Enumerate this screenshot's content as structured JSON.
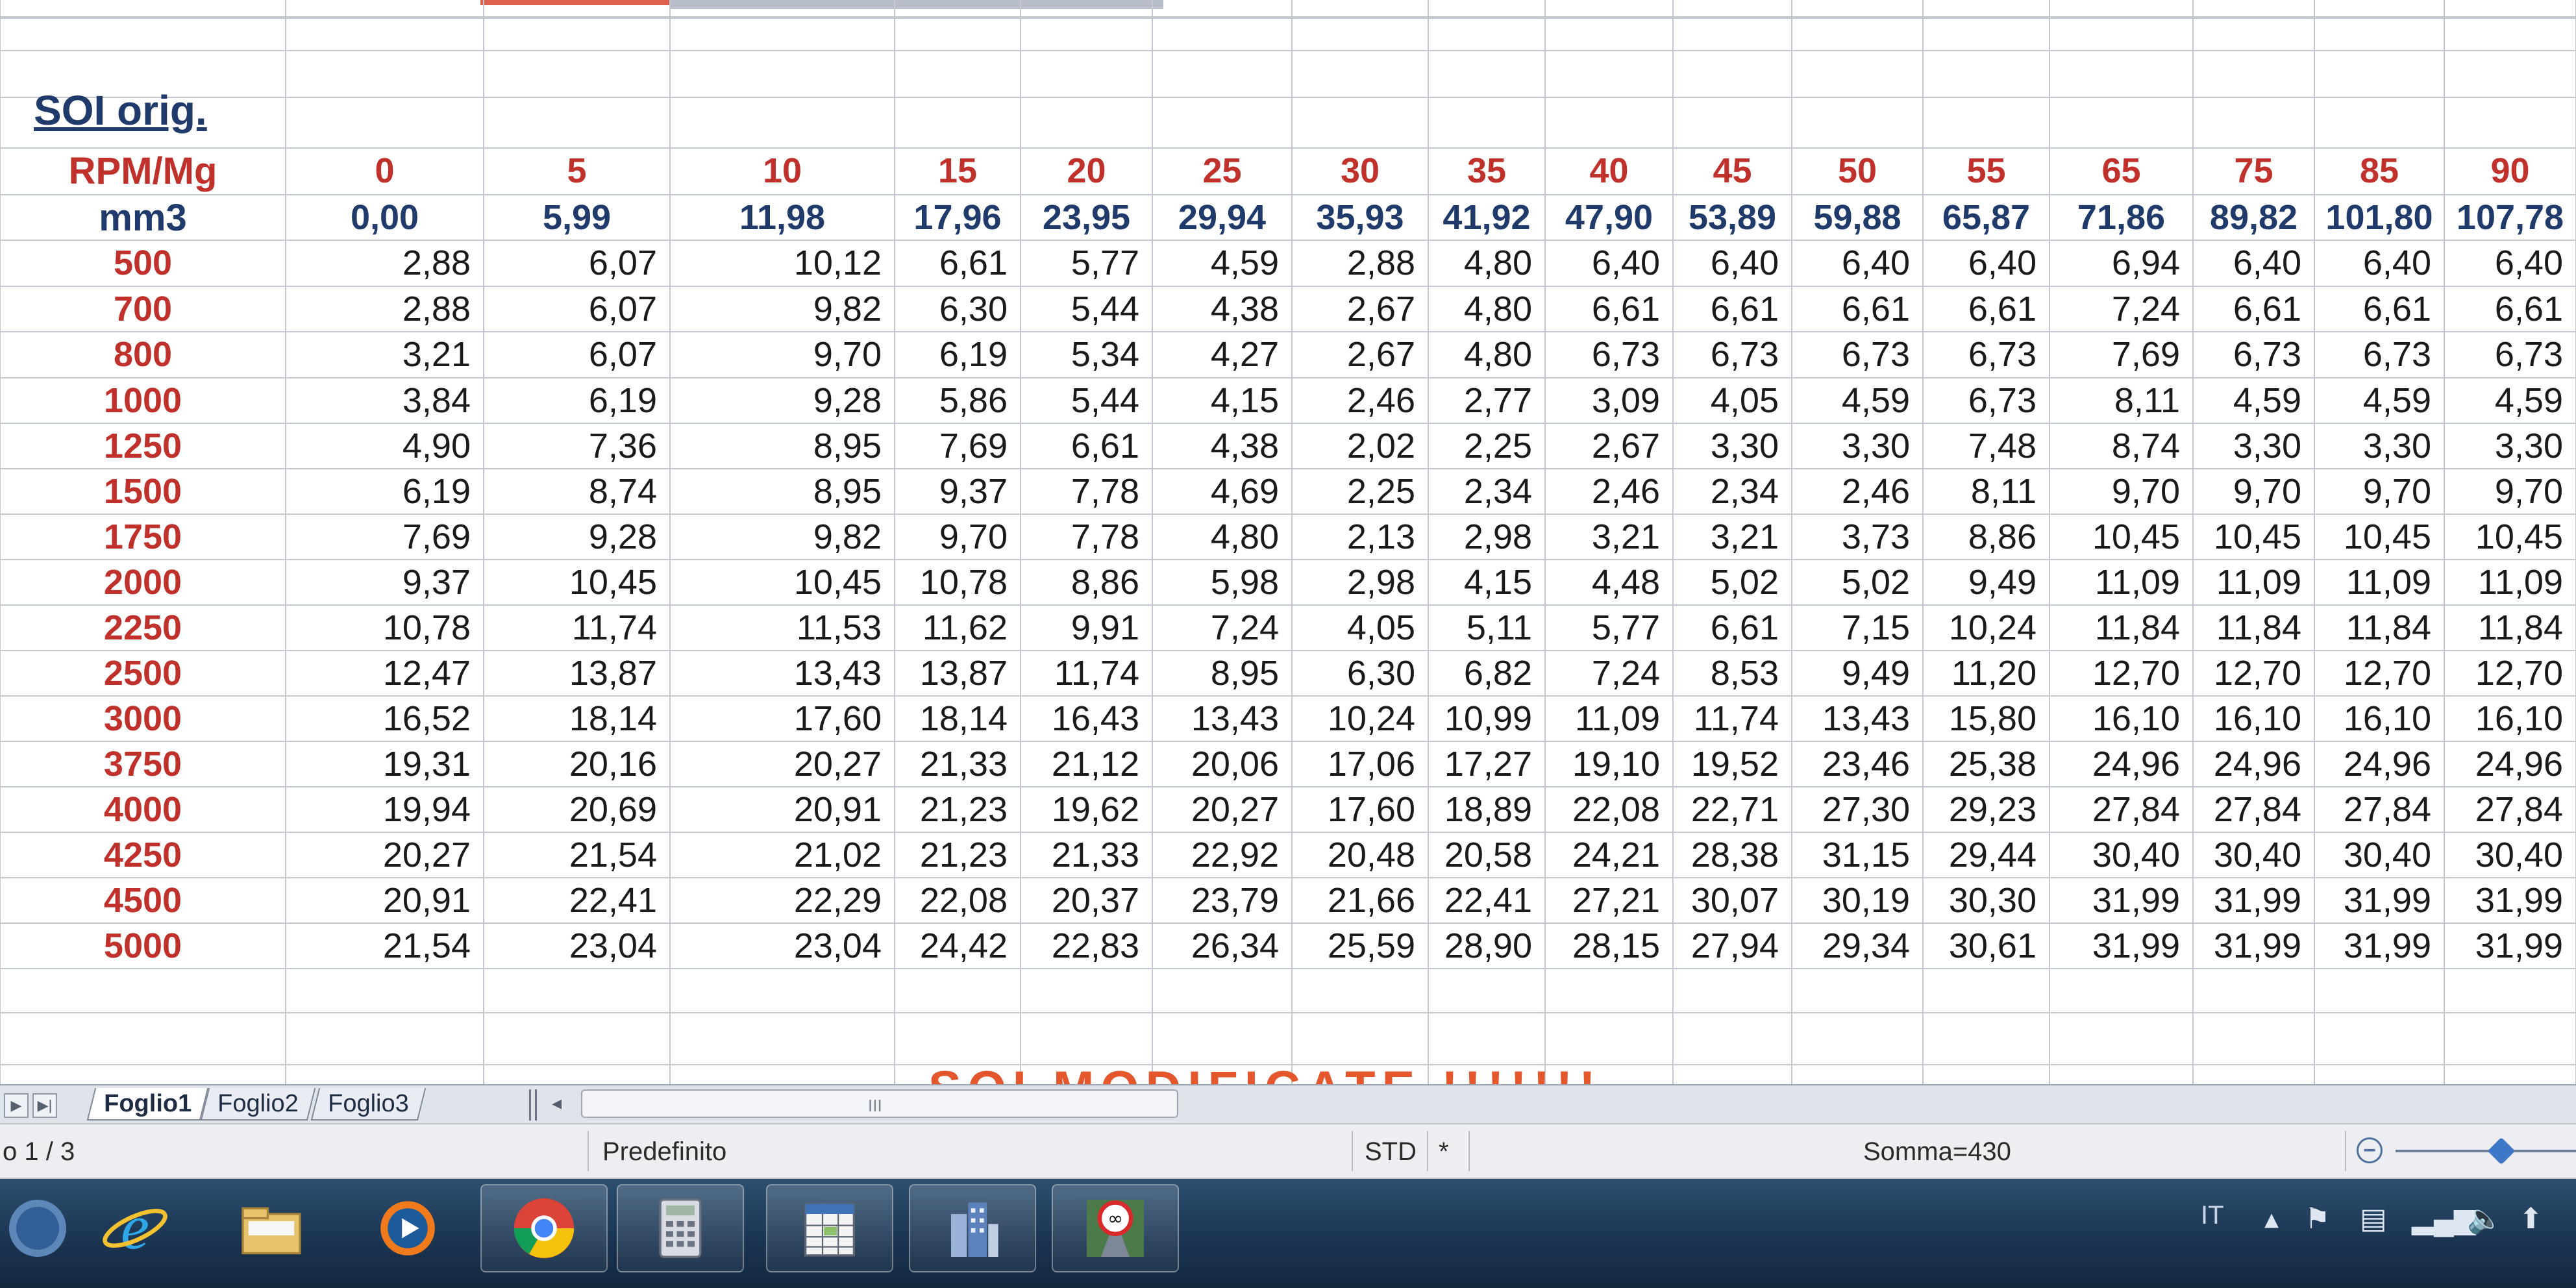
{
  "sheet": {
    "title": "SOI orig.",
    "row_label_1": "RPM/Mg",
    "row_label_2": "mm3",
    "col_headers_red": [
      "0",
      "5",
      "10",
      "15",
      "20",
      "25",
      "30",
      "35",
      "40",
      "45",
      "50",
      "55",
      "65",
      "75",
      "85",
      "90"
    ],
    "col_headers_blue": [
      "0,00",
      "5,99",
      "11,98",
      "17,96",
      "23,95",
      "29,94",
      "35,93",
      "41,92",
      "47,90",
      "53,89",
      "59,88",
      "65,87",
      "71,86",
      "89,82",
      "101,80",
      "107,78"
    ],
    "rows": [
      {
        "rpm": "500",
        "values": [
          "2,88",
          "6,07",
          "10,12",
          "6,61",
          "5,77",
          "4,59",
          "2,88",
          "4,80",
          "6,40",
          "6,40",
          "6,40",
          "6,40",
          "6,94",
          "6,40",
          "6,40",
          "6,40"
        ]
      },
      {
        "rpm": "700",
        "values": [
          "2,88",
          "6,07",
          "9,82",
          "6,30",
          "5,44",
          "4,38",
          "2,67",
          "4,80",
          "6,61",
          "6,61",
          "6,61",
          "6,61",
          "7,24",
          "6,61",
          "6,61",
          "6,61"
        ]
      },
      {
        "rpm": "800",
        "values": [
          "3,21",
          "6,07",
          "9,70",
          "6,19",
          "5,34",
          "4,27",
          "2,67",
          "4,80",
          "6,73",
          "6,73",
          "6,73",
          "6,73",
          "7,69",
          "6,73",
          "6,73",
          "6,73"
        ]
      },
      {
        "rpm": "1000",
        "values": [
          "3,84",
          "6,19",
          "9,28",
          "5,86",
          "5,44",
          "4,15",
          "2,46",
          "2,77",
          "3,09",
          "4,05",
          "4,59",
          "6,73",
          "8,11",
          "4,59",
          "4,59",
          "4,59"
        ]
      },
      {
        "rpm": "1250",
        "values": [
          "4,90",
          "7,36",
          "8,95",
          "7,69",
          "6,61",
          "4,38",
          "2,02",
          "2,25",
          "2,67",
          "3,30",
          "3,30",
          "7,48",
          "8,74",
          "3,30",
          "3,30",
          "3,30"
        ]
      },
      {
        "rpm": "1500",
        "values": [
          "6,19",
          "8,74",
          "8,95",
          "9,37",
          "7,78",
          "4,69",
          "2,25",
          "2,34",
          "2,46",
          "2,34",
          "2,46",
          "8,11",
          "9,70",
          "9,70",
          "9,70",
          "9,70"
        ]
      },
      {
        "rpm": "1750",
        "values": [
          "7,69",
          "9,28",
          "9,82",
          "9,70",
          "7,78",
          "4,80",
          "2,13",
          "2,98",
          "3,21",
          "3,21",
          "3,73",
          "8,86",
          "10,45",
          "10,45",
          "10,45",
          "10,45"
        ]
      },
      {
        "rpm": "2000",
        "values": [
          "9,37",
          "10,45",
          "10,45",
          "10,78",
          "8,86",
          "5,98",
          "2,98",
          "4,15",
          "4,48",
          "5,02",
          "5,02",
          "9,49",
          "11,09",
          "11,09",
          "11,09",
          "11,09"
        ]
      },
      {
        "rpm": "2250",
        "values": [
          "10,78",
          "11,74",
          "11,53",
          "11,62",
          "9,91",
          "7,24",
          "4,05",
          "5,11",
          "5,77",
          "6,61",
          "7,15",
          "10,24",
          "11,84",
          "11,84",
          "11,84",
          "11,84"
        ]
      },
      {
        "rpm": "2500",
        "values": [
          "12,47",
          "13,87",
          "13,43",
          "13,87",
          "11,74",
          "8,95",
          "6,30",
          "6,82",
          "7,24",
          "8,53",
          "9,49",
          "11,20",
          "12,70",
          "12,70",
          "12,70",
          "12,70"
        ]
      },
      {
        "rpm": "3000",
        "values": [
          "16,52",
          "18,14",
          "17,60",
          "18,14",
          "16,43",
          "13,43",
          "10,24",
          "10,99",
          "11,09",
          "11,74",
          "13,43",
          "15,80",
          "16,10",
          "16,10",
          "16,10",
          "16,10"
        ]
      },
      {
        "rpm": "3750",
        "values": [
          "19,31",
          "20,16",
          "20,27",
          "21,33",
          "21,12",
          "20,06",
          "17,06",
          "17,27",
          "19,10",
          "19,52",
          "23,46",
          "25,38",
          "24,96",
          "24,96",
          "24,96",
          "24,96"
        ]
      },
      {
        "rpm": "4000",
        "values": [
          "19,94",
          "20,69",
          "20,91",
          "21,23",
          "19,62",
          "20,27",
          "17,60",
          "18,89",
          "22,08",
          "22,71",
          "27,30",
          "29,23",
          "27,84",
          "27,84",
          "27,84",
          "27,84"
        ]
      },
      {
        "rpm": "4250",
        "values": [
          "20,27",
          "21,54",
          "21,02",
          "21,23",
          "21,33",
          "22,92",
          "20,48",
          "20,58",
          "24,21",
          "28,38",
          "31,15",
          "29,44",
          "30,40",
          "30,40",
          "30,40",
          "30,40"
        ]
      },
      {
        "rpm": "4500",
        "values": [
          "20,91",
          "22,41",
          "22,29",
          "22,08",
          "20,37",
          "23,79",
          "21,66",
          "22,41",
          "27,21",
          "30,07",
          "30,19",
          "30,30",
          "31,99",
          "31,99",
          "31,99",
          "31,99"
        ]
      },
      {
        "rpm": "5000",
        "values": [
          "21,54",
          "23,04",
          "23,04",
          "24,42",
          "22,83",
          "26,34",
          "25,59",
          "28,90",
          "28,15",
          "27,94",
          "29,34",
          "30,61",
          "31,99",
          "31,99",
          "31,99",
          "31,99"
        ]
      }
    ],
    "bottom_text": "SOI MODIFICATE !!!!!!!"
  },
  "tabs": {
    "items": [
      "Foglio1",
      "Foglio2",
      "Foglio3"
    ],
    "active": "Foglio1",
    "scroll_grip": "III"
  },
  "statusbar": {
    "page": "o 1 / 3",
    "style": "Predefinito",
    "mode": "STD",
    "flag": "*",
    "sum": "Somma=430",
    "zoom_minus": "−"
  },
  "taskbar": {
    "apps": [
      "internet-explorer",
      "file-explorer",
      "media-player",
      "chrome",
      "calculator",
      "spreadsheet",
      "buildings-app",
      "infinity-road-app"
    ],
    "language": "IT"
  },
  "colors": {
    "header_red": "#c0312b",
    "header_blue": "#1f3a6b",
    "bottom_text_orange": "#e4562b",
    "taskbar": "#1b3552"
  }
}
